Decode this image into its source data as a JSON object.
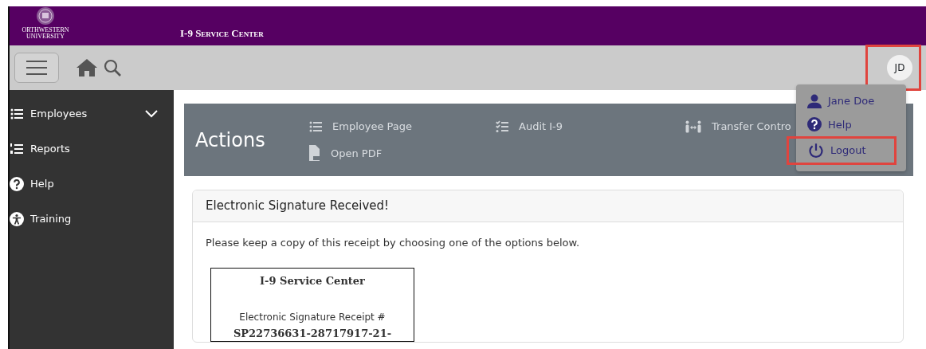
{
  "header": {
    "logo_name": "ORTHWESTERN",
    "logo_sub": "UNIVERSITY",
    "title": "I-9 Service Center"
  },
  "toolbar": {
    "avatar": "JD",
    "avatar_highlighted": true
  },
  "user_menu": {
    "items": [
      {
        "kind": "user",
        "label": "Jane Doe",
        "highlighted": false
      },
      {
        "kind": "help",
        "label": "Help",
        "highlighted": false
      },
      {
        "kind": "logout",
        "label": "Logout",
        "highlighted": true
      }
    ]
  },
  "sidebar": {
    "items": [
      {
        "kind": "list",
        "label": "Employees",
        "expandable": true
      },
      {
        "kind": "ranked",
        "label": "Reports",
        "expandable": false
      },
      {
        "kind": "help",
        "label": "Help",
        "expandable": false
      },
      {
        "kind": "access",
        "label": "Training",
        "expandable": false
      }
    ]
  },
  "actions": {
    "title": "Actions",
    "items": [
      {
        "kind": "list",
        "label": "Employee Page"
      },
      {
        "kind": "check",
        "label": "Audit I-9"
      },
      {
        "kind": "transfer",
        "label": "Transfer Contro"
      },
      {
        "kind": "pdf",
        "label": "Open PDF"
      }
    ]
  },
  "card": {
    "title": "Electronic Signature Received!",
    "text": "Please keep a copy of this receipt by choosing one of the options below.",
    "receipt": {
      "title": "I-9 Service Center",
      "label": "Electronic Signature Receipt #",
      "number": "SP22736631-28717917-21-"
    }
  }
}
